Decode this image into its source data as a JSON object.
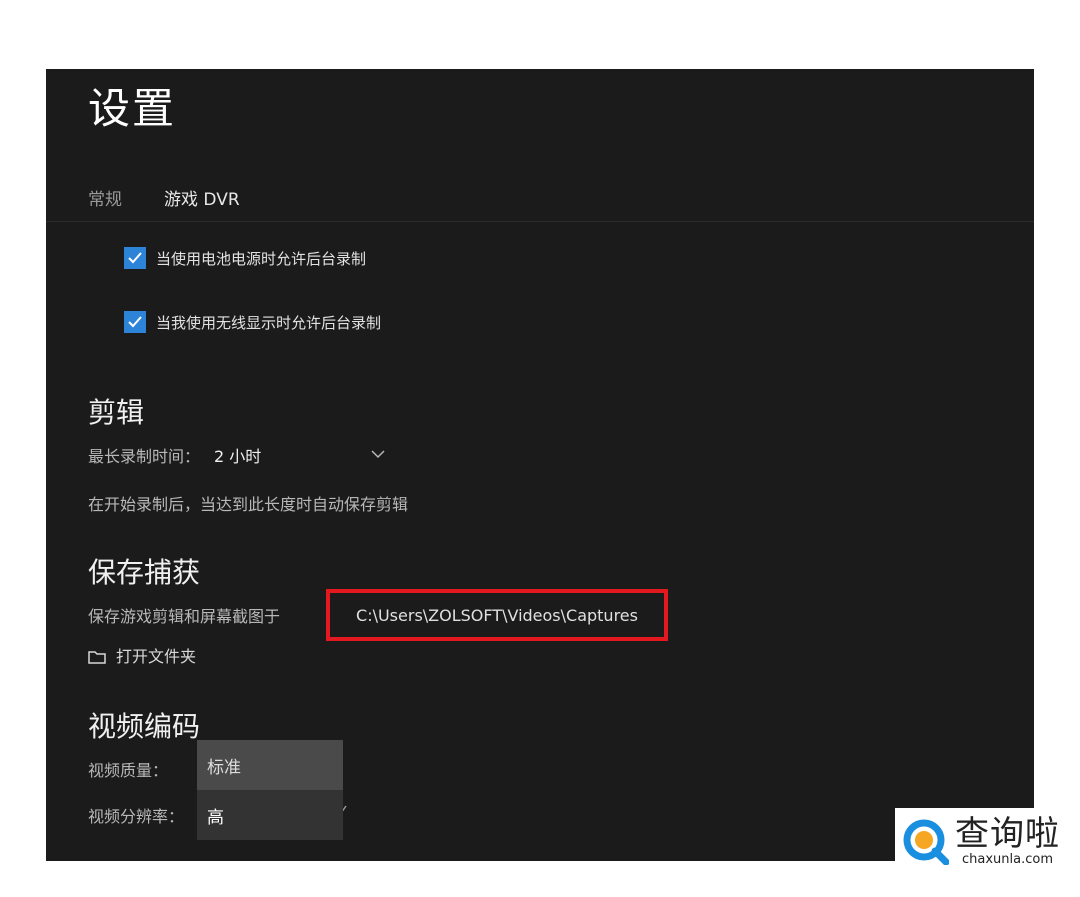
{
  "title": "设置",
  "tabs": [
    {
      "label": "常规"
    },
    {
      "label": "游戏 DVR"
    }
  ],
  "checkboxes": [
    {
      "label": "当使用电池电源时允许后台录制",
      "checked": true
    },
    {
      "label": "当我使用无线显示时允许后台录制",
      "checked": true
    }
  ],
  "clips": {
    "heading": "剪辑",
    "max_record_label": "最长录制时间：",
    "max_record_value": "2 小时",
    "description": "在开始录制后，当达到此长度时自动保存剪辑"
  },
  "save_captures": {
    "heading": "保存捕获",
    "save_to_label": "保存游戏剪辑和屏幕截图于",
    "path": "C:\\Users\\ZOLSOFT\\Videos\\Captures",
    "open_folder": "打开文件夹"
  },
  "video_encoding": {
    "heading": "视频编码",
    "quality_label": "视频质量：",
    "resolution_label": "视频分辨率：",
    "quality_options": [
      "标准",
      "高"
    ]
  },
  "watermark": {
    "cn": "查询啦",
    "en": "chaxunla.com"
  },
  "colors": {
    "panel_bg": "#1b1b1b",
    "checkbox_accent": "#2d83d8",
    "highlight_box": "#e3191f"
  }
}
